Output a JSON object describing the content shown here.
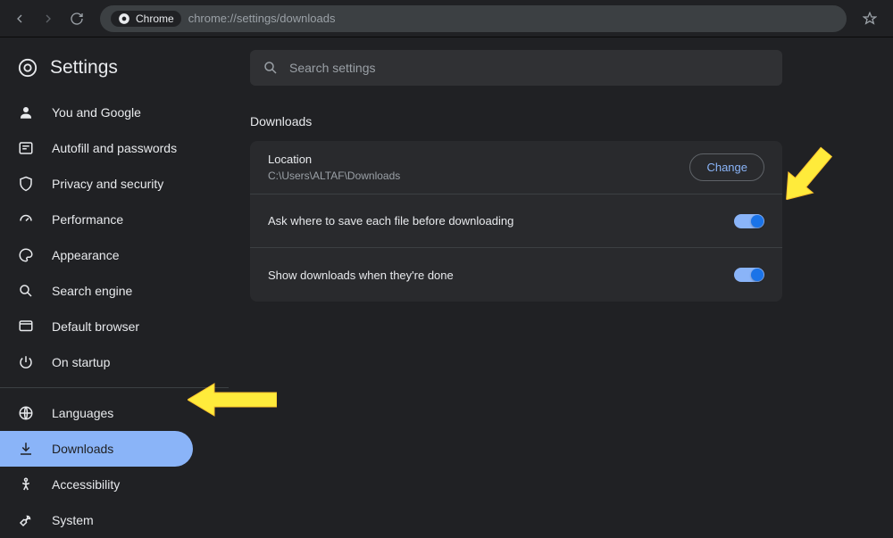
{
  "url": "chrome://settings/downloads",
  "chip": "Chrome",
  "app_title": "Settings",
  "search_placeholder": "Search settings",
  "section_title": "Downloads",
  "location": {
    "label": "Location",
    "path": "C:\\Users\\ALTAF\\Downloads",
    "button": "Change"
  },
  "rows": {
    "ask_label": "Ask where to save each file before downloading",
    "show_label": "Show downloads when they're done"
  },
  "nav": {
    "you": "You and Google",
    "autofill": "Autofill and passwords",
    "privacy": "Privacy and security",
    "performance": "Performance",
    "appearance": "Appearance",
    "search": "Search engine",
    "default": "Default browser",
    "startup": "On startup",
    "languages": "Languages",
    "downloads": "Downloads",
    "accessibility": "Accessibility",
    "system": "System"
  }
}
